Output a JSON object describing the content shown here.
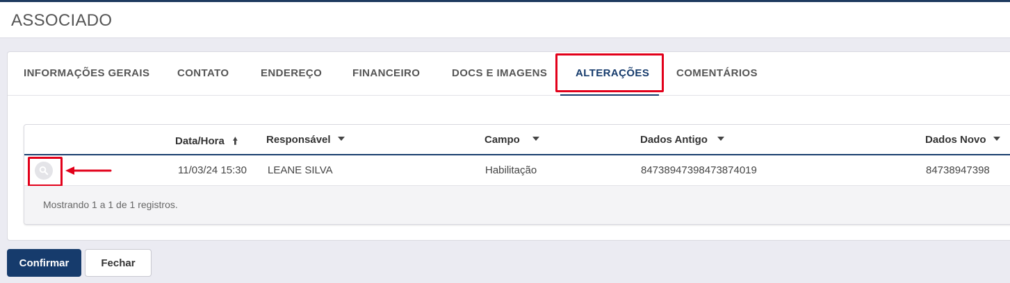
{
  "page": {
    "title": "ASSOCIADO"
  },
  "tabs": [
    {
      "label": "INFORMAÇÕES GERAIS"
    },
    {
      "label": "CONTATO"
    },
    {
      "label": "ENDEREÇO"
    },
    {
      "label": "FINANCEIRO"
    },
    {
      "label": "DOCS E IMAGENS"
    },
    {
      "label": "ALTERAÇÕES",
      "active": true
    },
    {
      "label": "COMENTÁRIOS"
    }
  ],
  "grid": {
    "columns": [
      {
        "label": "Data/Hora",
        "sort": "asc"
      },
      {
        "label": "Responsável",
        "filter": true
      },
      {
        "label": "Campo",
        "filter": true
      },
      {
        "label": "Dados Antigo",
        "filter": true
      },
      {
        "label": "Dados Novo",
        "filter": true
      }
    ],
    "rows": [
      {
        "data_hora": "11/03/24 15:30",
        "responsavel": "LEANE SILVA",
        "campo": "Habilitação",
        "dados_antigo": "84738947398473874019",
        "dados_novo": "84738947398"
      }
    ],
    "footer": "Mostrando 1 a 1 de 1 registros."
  },
  "actions": {
    "confirm_label": "Confirmar",
    "close_label": "Fechar"
  },
  "colors": {
    "primary": "#163b6c",
    "highlight": "#e2001a",
    "background": "#ebebf2"
  },
  "icons": {
    "view": "search-icon",
    "sort": "arrow-up-icon",
    "filter": "caret-down-icon",
    "annotation": "arrow-left-icon"
  }
}
